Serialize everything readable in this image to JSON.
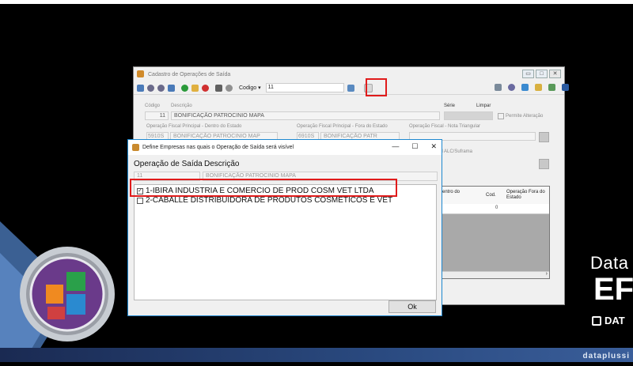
{
  "bg_window": {
    "title": "Cadastro de Operações de Saída",
    "toolbar": {
      "codigo_label": "Codigo",
      "codigo_value": "11"
    },
    "fields": {
      "codigo_label": "Código",
      "codigo_value": "11",
      "descricao_label": "Descrição",
      "descricao_value": "BONIFICAÇÃO PATROCINIO MAPA",
      "serie_label": "Série",
      "limpar_label": "Limpar",
      "permite_alteracao_label": "Permite Alteração",
      "op_dentro_label": "Operação Fiscal Principal - Dentro do Estado",
      "op_dentro_code": "5910S",
      "op_dentro_value": "BONIFICAÇÃO PATROCINIO MAP",
      "op_fora_label": "Operação Fiscal Principal - Fora do Estado",
      "op_fora_code": "6910S",
      "op_fora_value": "BONIFICAÇÃO PATR",
      "op_triang_label": "Operação Fiscal - Nota Triangular",
      "alc_label": "al ALC/Suframa"
    },
    "grid": {
      "col_dentro": "entro do",
      "col_cod": "Cod.",
      "col_fora": "Operação Fora do Estado",
      "row_cod": "0"
    }
  },
  "dialog": {
    "title": "Define Empresas nas quais o Operação de Saída será visível",
    "col_operacao": "Operação de Saída",
    "col_descricao": "Descrição",
    "selected_code": "11",
    "selected_desc": "BONIFICAÇÃO PATROCINIO MAPA",
    "items": [
      {
        "label": "1-IBIRA INDUSTRIA E COMERCIO DE PROD COSM VET LTDA",
        "checked": true
      },
      {
        "label": "2-CABALLE DISTRIBUIDORA DE PRODUTOS COSMETICOS E VET",
        "checked": false
      }
    ],
    "ok_label": "Ok"
  },
  "branding": {
    "line1": "Data",
    "line2": "EF",
    "line3": "DAT",
    "url": "dataplussi"
  },
  "colors": {
    "highlight": "#e01b1b",
    "dialog_border": "#1e88d0"
  }
}
